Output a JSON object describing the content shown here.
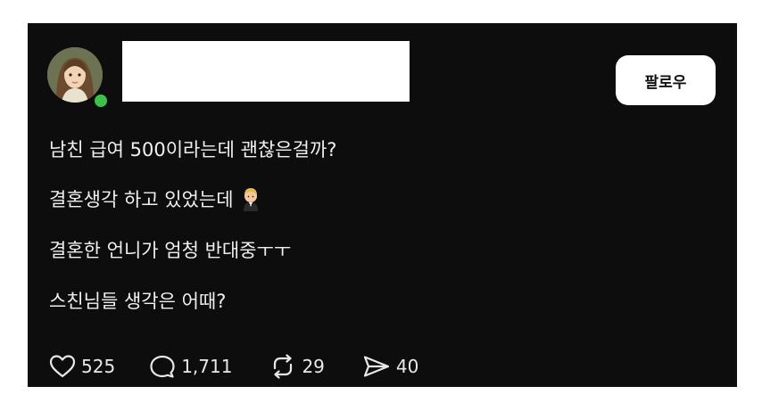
{
  "post": {
    "author_avatar_icon": "avatar-illustration",
    "follow_label": "팔로우",
    "lines": [
      "남친 급여 500이라는데 괜찮은걸까?",
      "결혼생각 하고 있었는데",
      "결혼한 언니가 엄청 반대중ㅜㅜ",
      "스친님들 생각은 어때?"
    ],
    "emoji_icon": "person-in-tuxedo-emoji"
  },
  "actions": {
    "likes": "525",
    "comments": "1,711",
    "reposts": "29",
    "shares": "40"
  },
  "colors": {
    "background": "#0d0d0d",
    "text": "#f0f0f0",
    "online": "#3ac24a"
  }
}
